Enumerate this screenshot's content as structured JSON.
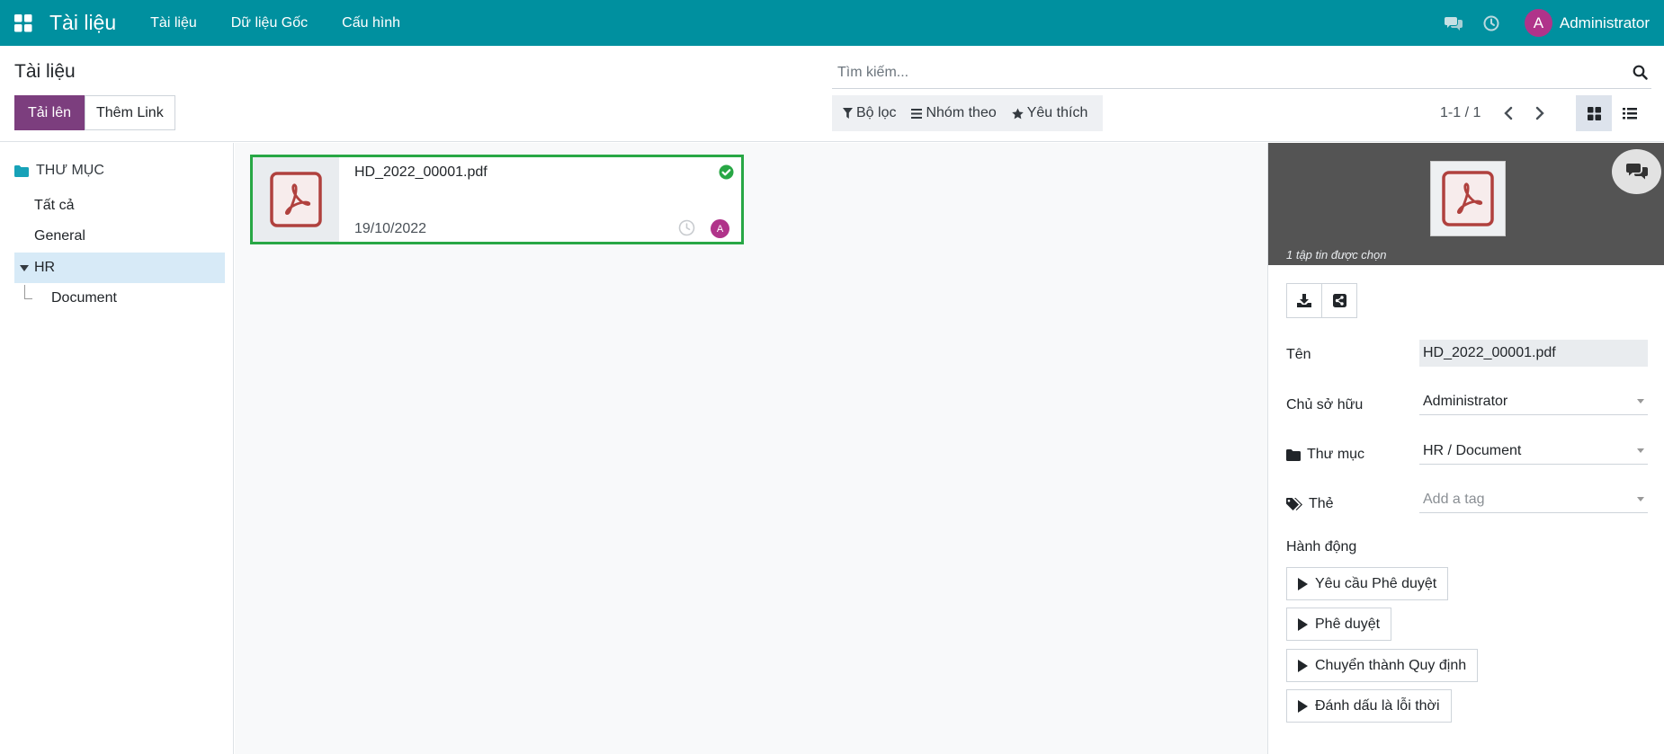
{
  "navbar": {
    "app_title": "Tài liệu",
    "menu": [
      "Tài liệu",
      "Dữ liệu Gốc",
      "Cấu hình"
    ],
    "user_initial": "A",
    "user_name": "Administrator",
    "bg_color": "#00909f"
  },
  "control": {
    "breadcrumb": "Tài liệu",
    "upload_label": "Tải lên",
    "add_link_label": "Thêm Link",
    "search_placeholder": "Tìm kiếm...",
    "filters_label": "Bộ lọc",
    "group_by_label": "Nhóm theo",
    "favorites_label": "Yêu thích",
    "pager": "1-1 / 1"
  },
  "sidebar": {
    "header": "THƯ MỤC",
    "all": "Tất cả",
    "general": "General",
    "hr": "HR",
    "document": "Document"
  },
  "card": {
    "name": "HD_2022_00001.pdf",
    "date": "19/10/2022",
    "avatar_initial": "A",
    "status_color": "#28a745"
  },
  "inspector": {
    "caption": "1 tập tin được chọn",
    "fields": {
      "name_label": "Tên",
      "name_value": "HD_2022_00001.pdf",
      "owner_label": "Chủ sở hữu",
      "owner_value": "Administrator",
      "folder_label": "Thư mục",
      "folder_value": "HR / Document",
      "tags_label": "Thẻ",
      "tags_placeholder": "Add a tag"
    },
    "actions_label": "Hành động",
    "actions": [
      "Yêu cầu Phê duyệt",
      "Phê duyệt",
      "Chuyển thành Quy định",
      "Đánh dấu là lỗi thời"
    ]
  },
  "icons": {
    "apps": "grid-icon",
    "chat": "chat-icon",
    "activity": "clock-icon",
    "search": "search-icon",
    "filter": "funnel-icon",
    "group": "bars-icon",
    "favorite": "star-icon",
    "prev": "chevron-left-icon",
    "next": "chevron-right-icon",
    "kanban": "kanban-icon",
    "list": "list-icon",
    "folder": "folder-icon",
    "pdf": "pdf-icon",
    "download": "download-icon",
    "share": "share-icon",
    "tags": "tags-icon"
  },
  "colors": {
    "primary": "#7c3e7e",
    "accent": "#00909f",
    "avatar": "#b0338a",
    "success": "#28a745"
  }
}
